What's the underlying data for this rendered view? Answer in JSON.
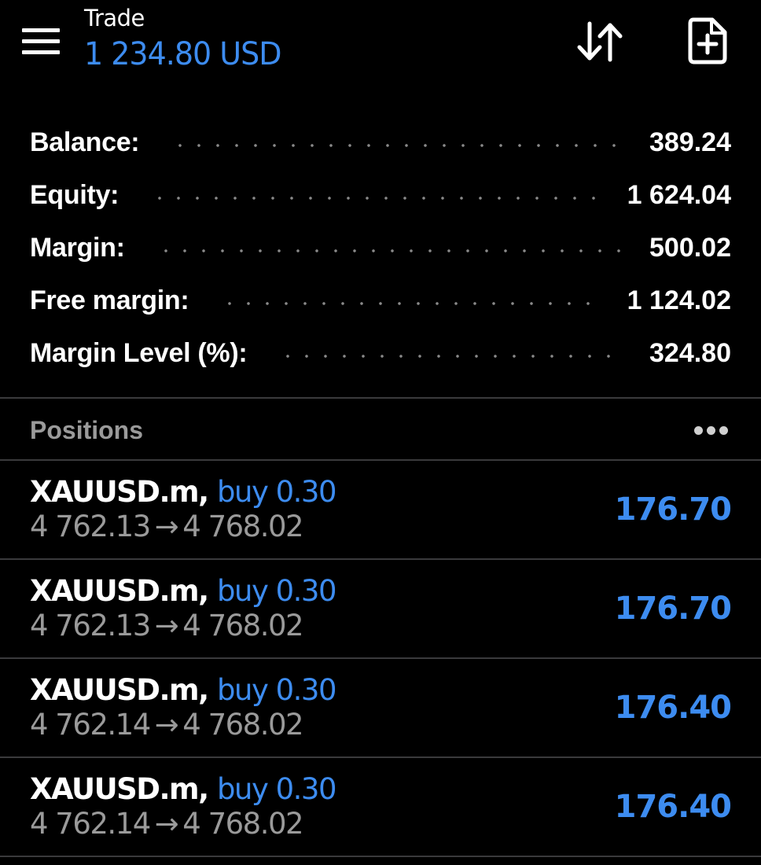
{
  "header": {
    "title": "Trade",
    "account_balance": "1 234.80 USD",
    "menu_icon": "hamburger-menu-icon",
    "sort_icon": "sort-arrows-icon",
    "new_order_icon": "new-document-plus-icon"
  },
  "summary": [
    {
      "label": "Balance:",
      "value": "389.24"
    },
    {
      "label": "Equity:",
      "value": "1 624.04"
    },
    {
      "label": "Margin:",
      "value": "500.02"
    },
    {
      "label": "Free margin:",
      "value": "1 124.02"
    },
    {
      "label": "Margin Level (%):",
      "value": "324.80"
    }
  ],
  "positions": {
    "title": "Positions",
    "more_icon": "more-dots-icon",
    "items": [
      {
        "symbol": "XAUUSD.m",
        "type": "buy 0.30",
        "open_price": "4 762.13",
        "current_price": "4 768.02",
        "profit": "176.70"
      },
      {
        "symbol": "XAUUSD.m",
        "type": "buy 0.30",
        "open_price": "4 762.13",
        "current_price": "4 768.02",
        "profit": "176.70"
      },
      {
        "symbol": "XAUUSD.m",
        "type": "buy 0.30",
        "open_price": "4 762.14",
        "current_price": "4 768.02",
        "profit": "176.40"
      },
      {
        "symbol": "XAUUSD.m",
        "type": "buy 0.30",
        "open_price": "4 762.14",
        "current_price": "4 768.02",
        "profit": "176.40"
      }
    ]
  },
  "colors": {
    "background": "#000000",
    "accent_blue": "#3d8cf0",
    "text_primary": "#ffffff",
    "text_secondary": "#9a9a9a",
    "divider": "#3a3a3c"
  }
}
